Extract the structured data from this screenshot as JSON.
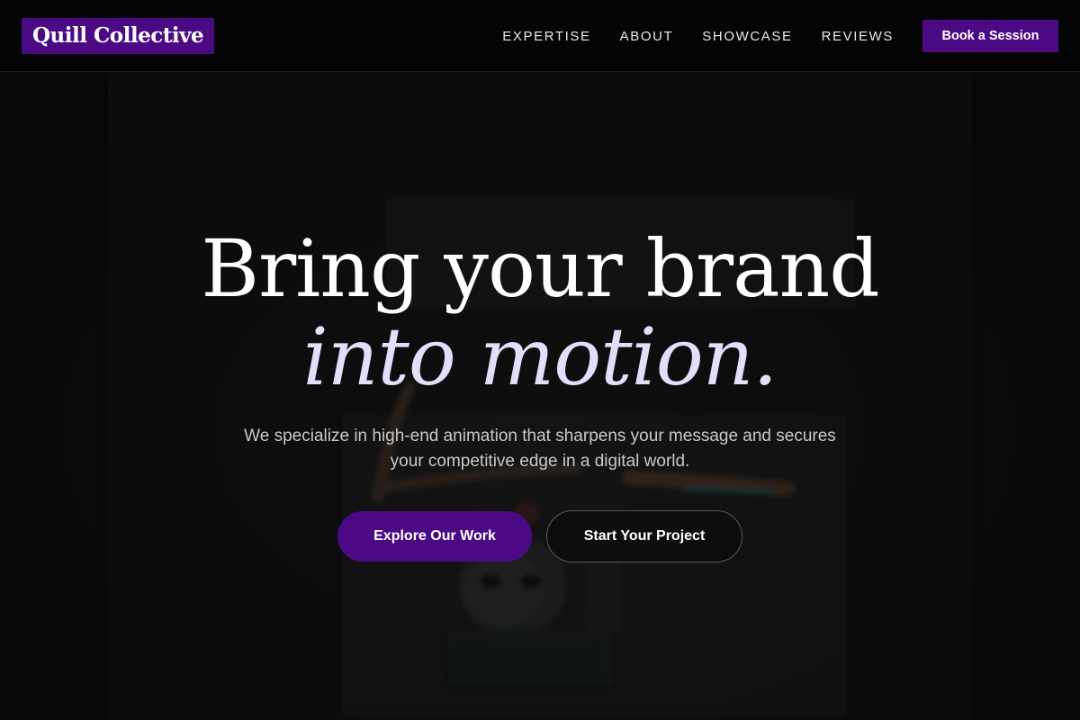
{
  "header": {
    "logo_text": "Quill Collective",
    "nav": [
      {
        "label": "EXPERTISE"
      },
      {
        "label": "ABOUT"
      },
      {
        "label": "SHOWCASE"
      },
      {
        "label": "REVIEWS"
      }
    ],
    "cta_label": "Book a Session"
  },
  "hero": {
    "headline_line1": "Bring your brand",
    "headline_line2": "into motion.",
    "subtext": "We specialize in high-end animation that sharpens your message and secures your competitive edge in a digital world.",
    "primary_button": "Explore Our Work",
    "secondary_button": "Start Your Project"
  },
  "colors": {
    "brand_purple": "#4b0a84",
    "background": "#0b0b0b",
    "headline_italic": "#e4defc"
  }
}
